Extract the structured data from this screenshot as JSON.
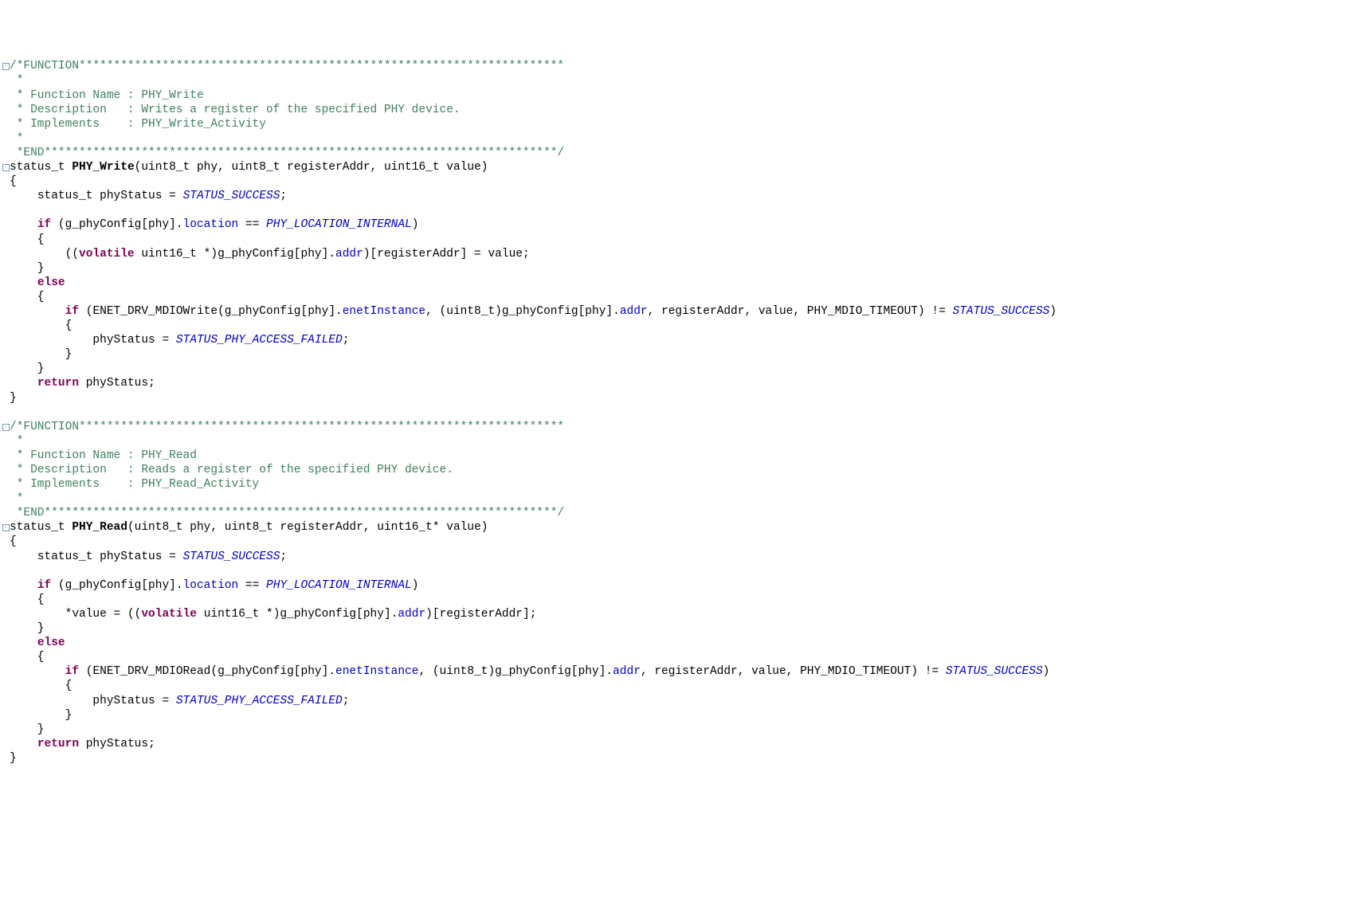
{
  "fold_glyph": "⊟",
  "func1": {
    "hdr1": "/*FUNCTION**********************************************************************",
    "hdr2": " *",
    "hdr3": " * Function Name : PHY_Write",
    "hdr4": " * Description   : Writes a register of the specified PHY device.",
    "hdr5": " * Implements    : PHY_Write_Activity",
    "hdr6": " *",
    "hdr7": " *END**************************************************************************/",
    "ret_t": "status_t",
    "name": "PHY_Write",
    "p1t": "uint8_t",
    "p1n": "phy",
    "p2t": "uint8_t",
    "p2n": "registerAddr",
    "p3t": "uint16_t",
    "p3n": "value",
    "var_t": "status_t",
    "var_n": "phyStatus",
    "init_const": "STATUS_SUCCESS",
    "kw_if": "if",
    "cfg": "g_phyConfig",
    "idx": "phy",
    "member_loc": "location",
    "loc_const": "PHY_LOCATION_INTERNAL",
    "kw_volatile": "volatile",
    "cast_t": "uint16_t",
    "member_addr": "addr",
    "arr_idx": "registerAddr",
    "assign_rhs": "value",
    "kw_else": "else",
    "call_fn": "ENET_DRV_MDIOWrite",
    "member_enet": "enetInstance",
    "cast2_t": "uint8_t",
    "arg3": "registerAddr",
    "arg4": "value",
    "arg5": "PHY_MDIO_TIMEOUT",
    "neq_const": "STATUS_SUCCESS",
    "fail_const": "STATUS_PHY_ACCESS_FAILED",
    "kw_return": "return",
    "ret_var": "phyStatus"
  },
  "func2": {
    "hdr1": "/*FUNCTION**********************************************************************",
    "hdr2": " *",
    "hdr3": " * Function Name : PHY_Read",
    "hdr4": " * Description   : Reads a register of the specified PHY device.",
    "hdr5": " * Implements    : PHY_Read_Activity",
    "hdr6": " *",
    "hdr7": " *END**************************************************************************/",
    "ret_t": "status_t",
    "name": "PHY_Read",
    "p1t": "uint8_t",
    "p1n": "phy",
    "p2t": "uint8_t",
    "p2n": "registerAddr",
    "p3t": "uint16_t*",
    "p3n": "value",
    "var_t": "status_t",
    "var_n": "phyStatus",
    "init_const": "STATUS_SUCCESS",
    "kw_if": "if",
    "cfg": "g_phyConfig",
    "idx": "phy",
    "member_loc": "location",
    "loc_const": "PHY_LOCATION_INTERNAL",
    "deref_lhs": "*value",
    "kw_volatile": "volatile",
    "cast_t": "uint16_t",
    "member_addr": "addr",
    "arr_idx": "registerAddr",
    "kw_else": "else",
    "call_fn": "ENET_DRV_MDIORead",
    "member_enet": "enetInstance",
    "cast2_t": "uint8_t",
    "arg3": "registerAddr",
    "arg4": "value",
    "arg5": "PHY_MDIO_TIMEOUT",
    "neq_const": "STATUS_SUCCESS",
    "fail_const": "STATUS_PHY_ACCESS_FAILED",
    "kw_return": "return",
    "ret_var": "phyStatus"
  }
}
